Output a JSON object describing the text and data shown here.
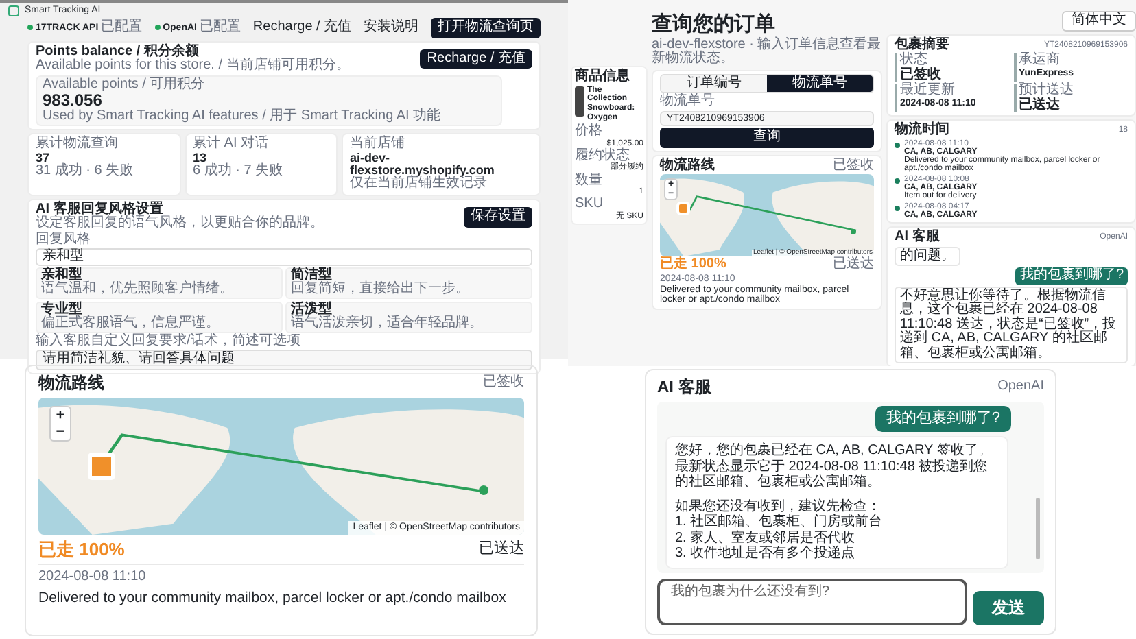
{
  "admin": {
    "app_title": "Smart Tracking AI",
    "services": [
      {
        "name": "17TRACK API",
        "status": "已配置",
        "color": "#22a55a"
      },
      {
        "name": "OpenAI",
        "status": "已配置",
        "color": "#22a55a"
      }
    ],
    "links": [
      "Recharge / 充值",
      "安装说明"
    ],
    "open_button": "打开物流查询页",
    "balance": {
      "title": "Points balance / 积分余额",
      "subtitle": "Available points for this store. / 当前店铺可用积分。",
      "button": "Recharge / 充值",
      "label": "Available points / 可用积分",
      "value": "983.056",
      "note": "Used by Smart Tracking AI features / 用于 Smart Tracking AI 功能"
    },
    "stats": [
      {
        "label": "累计物流查询",
        "value": "37",
        "note": "31 成功 · 6 失败"
      },
      {
        "label": "累计 AI 对话",
        "value": "13",
        "note": "6 成功 · 7 失败"
      },
      {
        "label": "当前店铺",
        "value": "ai-dev-flexstore.myshopify.com",
        "note": "仅在当前店铺生效记录"
      }
    ],
    "settings": {
      "title": "AI 客服回复风格设置",
      "subtitle": "设定客服回复的语气风格，以更贴合你的品牌。",
      "button": "保存设置",
      "style_label": "回复风格",
      "style_value": "亲和型",
      "styles": [
        {
          "name": "亲和型",
          "desc": "语气温和，优先照顾客户情绪。"
        },
        {
          "name": "简洁型",
          "desc": "回复简短，直接给出下一步。"
        },
        {
          "name": "专业型",
          "desc": "偏正式客服语气，信息严谨。"
        },
        {
          "name": "活泼型",
          "desc": "语气活泼亲切，适合年轻品牌。"
        }
      ],
      "custom_label": "输入客服自定义回复要求/话术，简述可选项",
      "custom_value": "请用简洁礼貌、请回答具体问题"
    }
  },
  "tracker": {
    "product": {
      "heading": "商品信息",
      "name": "The Collection Snowboard: Oxygen",
      "rows": [
        {
          "label": "价格",
          "value": "$1,025.00"
        },
        {
          "label": "履约状态",
          "value": "部分履约"
        },
        {
          "label": "数量",
          "value": "1"
        },
        {
          "label": "SKU",
          "value": "无 SKU"
        }
      ]
    },
    "title": "查询您的订单",
    "subtitle": "ai-dev-flexstore · 输入订单信息查看最新物流状态。",
    "tabs": [
      {
        "label": "订单编号",
        "selected": false
      },
      {
        "label": "物流单号",
        "selected": true
      }
    ],
    "field_label": "物流单号",
    "field_value": "YT2408210969153906",
    "search_button": "查询",
    "route": {
      "title": "物流路线",
      "status": "已签收",
      "zoom_in": "+",
      "zoom_out": "−",
      "attribution": "Leaflet | © OpenStreetMap contributors",
      "progress": "已走 100%",
      "delivered": "已送达",
      "time": "2024-08-08 11:10",
      "desc": "Delivered to your community mailbox, parcel locker or apt./condo mailbox"
    },
    "language": "简体中文",
    "summary": {
      "title": "包裹摘要",
      "number": "YT2408210969153906",
      "cells": [
        {
          "label": "状态",
          "value": "已签收"
        },
        {
          "label": "承运商",
          "value": "YunExpress"
        },
        {
          "label": "最近更新",
          "value": "2024-08-08 11:10"
        },
        {
          "label": "预计送达",
          "value": "已送达"
        }
      ]
    },
    "timeline": {
      "title": "物流时间",
      "count": "18",
      "events": [
        {
          "time": "2024-08-08 11:10",
          "place": "CA, AB, CALGARY",
          "desc": "Delivered to your community mailbox, parcel locker or apt./condo mailbox"
        },
        {
          "time": "2024-08-08 10:08",
          "place": "CA, AB, CALGARY",
          "desc": "Item out for delivery"
        },
        {
          "time": "2024-08-08 04:17",
          "place": "CA, AB, CALGARY"
        }
      ]
    },
    "chat": {
      "title": "AI 客服",
      "provider": "OpenAI",
      "messages": [
        {
          "kind": "bot",
          "text": "的问题。"
        },
        {
          "kind": "user",
          "text": "我的包裹到哪了?"
        },
        {
          "kind": "bot",
          "text": "不好意思让你等待了。根据物流信息，这个包裹已经在 2024-08-08 11:10:48 送达，状态是“已签收”，投递到 CA, AB, CALGARY 的社区邮箱、包裹柜或公寓邮箱。"
        }
      ]
    }
  },
  "route_card": {
    "title": "物流路线",
    "status": "已签收",
    "zoom_in": "+",
    "zoom_out": "−",
    "attribution": "Leaflet | © OpenStreetMap contributors",
    "progress": "已走 100%",
    "delivered": "已送达",
    "time": "2024-08-08 11:10",
    "desc": "Delivered to your community mailbox, parcel locker or apt./condo mailbox"
  },
  "chat_card": {
    "title": "AI 客服",
    "provider": "OpenAI",
    "messages": [
      {
        "kind": "user",
        "paragraphs": [
          [
            "我的包裹到哪了?"
          ]
        ]
      },
      {
        "kind": "bot",
        "paragraphs": [
          [
            "您好，您的包裹已经在 CA, AB, CALGARY 签收了。最新状态显示它于 2024-08-08 11:10:48 被投递到您的社区邮箱、包裹柜或公寓邮箱。"
          ],
          [
            "如果您还没有收到，建议先检查：",
            "1. 社区邮箱、包裹柜、门房或前台",
            "2. 家人、室友或邻居是否代收",
            "3. 收件地址是否有多个投递点"
          ]
        ]
      }
    ],
    "input_placeholder": "我的包裹为什么还没有到?",
    "send_button": "发送"
  }
}
